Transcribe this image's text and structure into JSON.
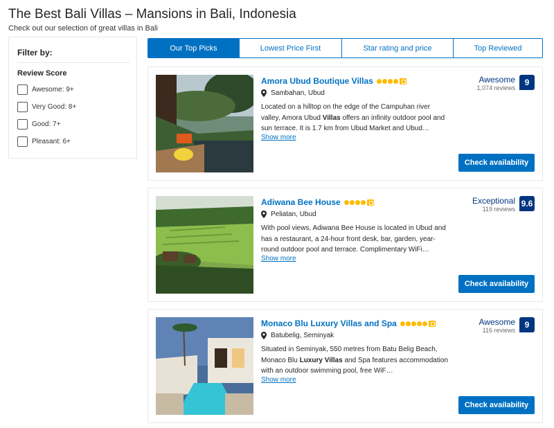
{
  "page": {
    "title": "The Best Bali Villas – Mansions in Bali, Indonesia",
    "subtitle": "Check out our selection of great villas in Bali"
  },
  "filter": {
    "heading": "Filter by:",
    "group_title": "Review Score",
    "options": [
      {
        "label": "Awesome: 9+"
      },
      {
        "label": "Very Good: 8+"
      },
      {
        "label": "Good: 7+"
      },
      {
        "label": "Pleasant: 6+"
      }
    ]
  },
  "tabs": [
    {
      "label": "Our Top Picks",
      "active": true
    },
    {
      "label": "Lowest Price First",
      "active": false
    },
    {
      "label": "Star rating and price",
      "active": false
    },
    {
      "label": "Top Reviewed",
      "active": false
    }
  ],
  "show_more_label": "Show more",
  "check_label": "Check availability",
  "colors": {
    "brand_blue": "#0071c2",
    "score_navy": "#003580",
    "star_yellow": "#febb02"
  },
  "properties": [
    {
      "name": "Amora Ubud Boutique Villas",
      "stars": 4,
      "location": "Sambahan, Ubud",
      "desc_pre": "Located on a hilltop on the edge of the Campuhan river valley, Amora Ubud ",
      "desc_bold": "Villas",
      "desc_post": " offers an infinity outdoor pool and sun terrace. It is 1.7 km from Ubud Market and Ubud…",
      "score_word": "Awesome",
      "review_count": "1,074 reviews",
      "score": "9"
    },
    {
      "name": "Adiwana Bee House",
      "stars": 4,
      "location": "Peliatan, Ubud",
      "desc_pre": "With pool views, Adiwana Bee House is located in Ubud and has a restaurant, a 24-hour front desk, bar, garden, year-round outdoor pool and terrace. Complimentary WiFi…",
      "desc_bold": "",
      "desc_post": "",
      "score_word": "Exceptional",
      "review_count": "119 reviews",
      "score": "9.6"
    },
    {
      "name": "Monaco Blu Luxury Villas and Spa",
      "stars": 5,
      "location": "Batubelig, Seminyak",
      "desc_pre": "Situated in Seminyak, 550 metres from Batu Belig Beach, Monaco Blu ",
      "desc_bold": "Luxury Villas",
      "desc_post": " and Spa features accommodation with an outdoor swimming pool, free WiF…",
      "score_word": "Awesome",
      "review_count": "116 reviews",
      "score": "9"
    }
  ]
}
